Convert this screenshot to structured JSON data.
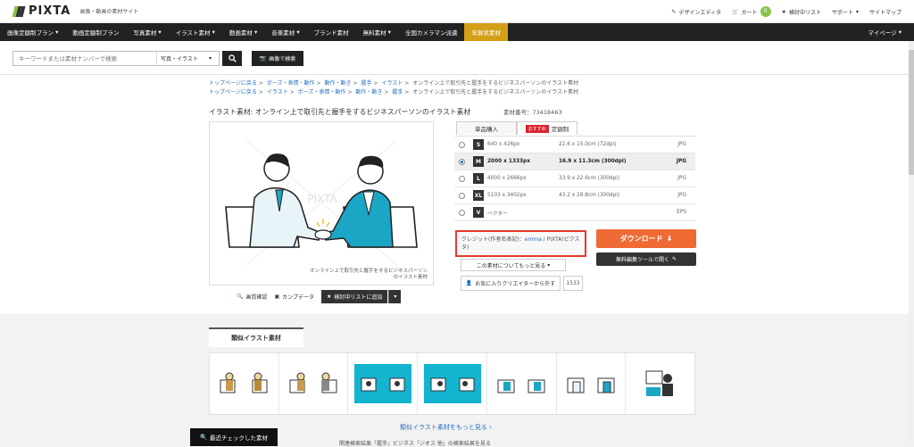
{
  "header": {
    "logo_text": "PIXTA",
    "tagline": "画像・動画の素材サイト",
    "links": {
      "design_editor": "デザインエディタ",
      "cart": "カート",
      "cart_count": "0",
      "wishlist": "検討中リスト",
      "support": "サポート",
      "sitemap": "サイトマップ"
    }
  },
  "nav": {
    "items": [
      "画像定額制プラン",
      "動画定額制プラン",
      "写真素材",
      "イラスト素材",
      "動画素材",
      "音楽素材",
      "ブランド素材",
      "無料素材",
      "全国カメラマン派遣",
      "年賀状素材"
    ],
    "mypage": "マイページ"
  },
  "search": {
    "placeholder": "キーワードまたは素材ナンバーで検索",
    "category": "写真・イラスト",
    "image_search_label": "画像で検索"
  },
  "breadcrumbs": {
    "line1": [
      "トップページに戻る",
      "ポーズ・表情・動作",
      "動作・動き",
      "握手",
      "イラスト"
    ],
    "line1_current": "オンライン上で取引先と握手をするビジネスパーソンのイラスト素材",
    "line2": [
      "トップページに戻る",
      "イラスト",
      "ポーズ・表情・動作",
      "動作・動き",
      "握手"
    ],
    "line2_current": "オンライン上で取引先と握手をするビジネスパーソンのイラスト素材"
  },
  "item": {
    "title": "イラスト素材: オンライン上で取引先と握手をするビジネスパーソンのイラスト素材",
    "material_no": "素材番号：73418463",
    "caption_line1": "オンライン上で取引先と握手をするビジネスパーソン",
    "caption_line2": "のイラスト素材",
    "watermark": "PIXTA",
    "zoom_label": "画質確認",
    "comp_label": "カンプデータ",
    "wishlist_add_label": "検討中リストに追加"
  },
  "purchase": {
    "tab_single": "単品購入",
    "tab_recommend": "おすすめ",
    "tab_plan": "定額制",
    "sizes": [
      {
        "size": "S",
        "px": "640 x 426px",
        "cm": "22.6 x 15.0cm (72dpi)",
        "format": "JPG",
        "selected": false
      },
      {
        "size": "M",
        "px": "2000 x 1333px",
        "cm": "16.9 x 11.3cm (300dpi)",
        "format": "JPG",
        "selected": true
      },
      {
        "size": "L",
        "px": "4000 x 2666px",
        "cm": "33.9 x 22.6cm (300dpi)",
        "format": "JPG",
        "selected": false
      },
      {
        "size": "XL",
        "px": "5103 x 3402px",
        "cm": "43.2 x 28.8cm (300dpi)",
        "format": "JPG",
        "selected": false
      },
      {
        "size": "V",
        "px": "ベクター",
        "cm": "",
        "format": "EPS",
        "selected": false
      }
    ],
    "credit_prefix": "クレジット(作者名表記)：",
    "credit_name": "emma",
    "credit_suffix": " / PIXTA(ピクスタ)",
    "more_info": "この素材についてもっと見る",
    "favorite_label": "お気に入りクリエイターから外す",
    "favorite_count": "1533",
    "download_label": "ダウンロード",
    "edit_label": "無料編集ツールで開く"
  },
  "similar": {
    "heading": "類似イラスト素材",
    "more_label": "類似イラスト素材をもっと見る"
  },
  "footer": {
    "recent_label": "最近チェックした素材",
    "cut_text": "関連検索結果「握手」ビジネス「ジオス 他」の検索結果を見る"
  },
  "colors": {
    "accent_orange": "#f06a35",
    "nav_bg": "#222222",
    "highlight_gold": "#d4a017",
    "link_blue": "#2a6fbf",
    "annotation_red": "#e33b2c"
  }
}
